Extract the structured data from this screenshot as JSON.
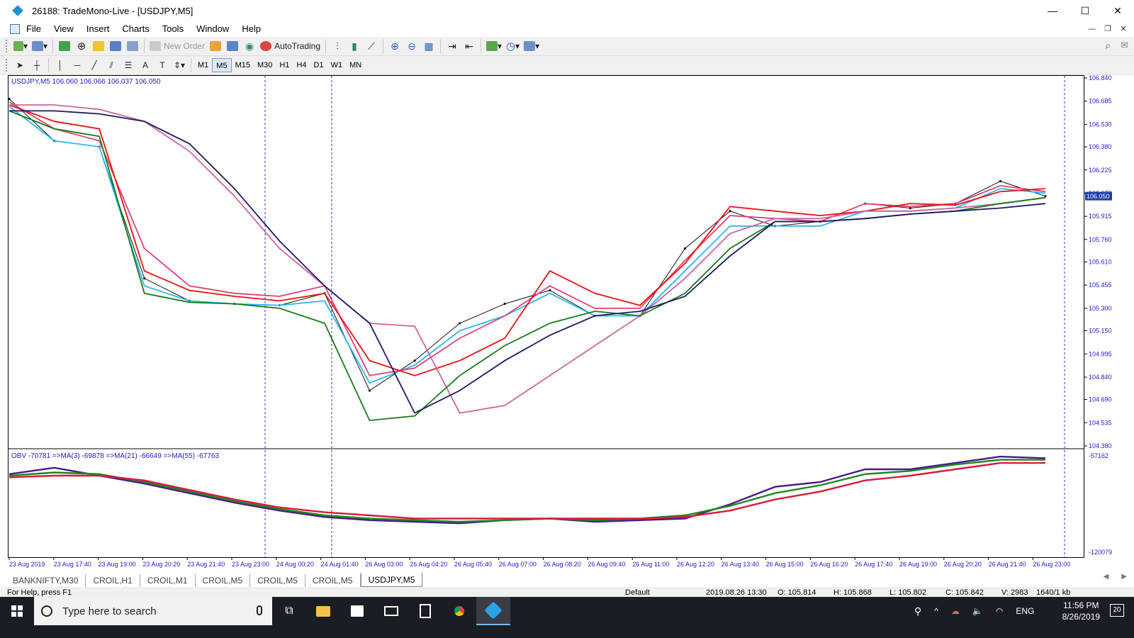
{
  "window": {
    "title": "26188: TradeMono-Live - [USDJPY,M5]",
    "minimize": "—",
    "maximize": "☐",
    "close": "✕"
  },
  "menu": [
    "File",
    "View",
    "Insert",
    "Charts",
    "Tools",
    "Window",
    "Help"
  ],
  "toolbar": {
    "new_order": "New Order",
    "autotrading": "AutoTrading"
  },
  "timeframes": [
    "M1",
    "M5",
    "M15",
    "M30",
    "H1",
    "H4",
    "D1",
    "W1",
    "MN"
  ],
  "active_timeframe": "M5",
  "chart": {
    "header": "USDJPY,M5  106.060 106.066 106.037 106.050",
    "current_price": "106.050",
    "price_ticks": [
      "106.840",
      "106.685",
      "106.530",
      "106.380",
      "106.225",
      "106.070",
      "105.915",
      "105.760",
      "105.610",
      "105.455",
      "105.300",
      "105.150",
      "104.995",
      "104.840",
      "104.690",
      "104.535",
      "104.380"
    ],
    "price_range": [
      104.38,
      106.84
    ],
    "time_labels": [
      "23 Aug 2019",
      "23 Aug 17:40",
      "23 Aug 19:00",
      "23 Aug 20:20",
      "23 Aug 21:40",
      "23 Aug 23:00",
      "24 Aug 00:20",
      "24 Aug 01:40",
      "26 Aug 03:00",
      "26 Aug 04:20",
      "26 Aug 05:40",
      "26 Aug 07:00",
      "26 Aug 08:20",
      "26 Aug 09:40",
      "26 Aug 11:00",
      "26 Aug 12:20",
      "26 Aug 13:40",
      "26 Aug 15:00",
      "26 Aug 16:20",
      "26 Aug 17:40",
      "26 Aug 19:00",
      "26 Aug 20:20",
      "26 Aug 21:40",
      "26 Aug 23:00"
    ],
    "indicator_header": "OBV -70781  =>MA(3) -69878  =>MA(21) -66649  =>MA(55) -67763",
    "indicator_ticks": [
      "-57162",
      "-120079"
    ]
  },
  "chart_data": {
    "type": "line",
    "title": "USDJPY,M5",
    "x": [
      "23 Aug 2019",
      "23 Aug 17:40",
      "23 Aug 19:00",
      "23 Aug 20:20",
      "23 Aug 21:40",
      "23 Aug 23:00",
      "24 Aug 00:20",
      "24 Aug 01:40",
      "26 Aug 03:00",
      "26 Aug 04:20",
      "26 Aug 05:40",
      "26 Aug 07:00",
      "26 Aug 08:20",
      "26 Aug 09:40",
      "26 Aug 11:00",
      "26 Aug 12:20",
      "26 Aug 13:40",
      "26 Aug 15:00",
      "26 Aug 16:20",
      "26 Aug 17:40",
      "26 Aug 19:00",
      "26 Aug 20:20",
      "26 Aug 21:40",
      "26 Aug 23:00"
    ],
    "series": [
      {
        "name": "USDJPY",
        "color": "#111111",
        "values": [
          106.7,
          106.42,
          106.38,
          105.5,
          105.35,
          105.33,
          105.32,
          105.4,
          104.75,
          104.95,
          105.2,
          105.33,
          105.42,
          105.25,
          105.25,
          105.7,
          105.95,
          105.85,
          105.88,
          106.0,
          105.97,
          106.0,
          106.15,
          106.05
        ]
      },
      {
        "color": "#29b6f6",
        "values": [
          106.65,
          106.42,
          106.38,
          105.45,
          105.35,
          105.33,
          105.32,
          105.35,
          104.8,
          104.92,
          105.15,
          105.25,
          105.4,
          105.25,
          105.25,
          105.55,
          105.85,
          105.85,
          105.85,
          105.95,
          105.95,
          105.97,
          106.1,
          106.07
        ]
      },
      {
        "color": "#e0407a",
        "values": [
          106.68,
          106.5,
          106.42,
          105.7,
          105.45,
          105.4,
          105.38,
          105.45,
          104.85,
          104.9,
          105.1,
          105.25,
          105.45,
          105.3,
          105.3,
          105.62,
          105.92,
          105.9,
          105.88,
          106.0,
          105.98,
          106.0,
          106.12,
          106.08
        ]
      },
      {
        "color": "#ee1111",
        "values": [
          106.66,
          106.55,
          106.5,
          105.55,
          105.42,
          105.38,
          105.35,
          105.4,
          104.95,
          104.85,
          104.95,
          105.1,
          105.55,
          105.4,
          105.32,
          105.6,
          105.98,
          105.95,
          105.92,
          105.95,
          106.0,
          105.99,
          106.08,
          106.1
        ]
      },
      {
        "color": "#cc6699",
        "values": [
          106.66,
          106.66,
          106.63,
          106.55,
          106.35,
          106.05,
          105.7,
          105.45,
          105.2,
          105.18,
          104.6,
          104.65,
          104.85,
          105.05,
          105.25,
          105.5,
          105.8,
          105.9,
          105.9,
          105.95,
          105.95,
          105.97,
          106.0,
          106.04
        ]
      },
      {
        "color": "#1a7a1a",
        "values": [
          106.62,
          106.5,
          106.45,
          105.4,
          105.34,
          105.33,
          105.3,
          105.2,
          104.55,
          104.58,
          104.85,
          105.05,
          105.2,
          105.28,
          105.25,
          105.4,
          105.7,
          105.88,
          105.88,
          105.9,
          105.93,
          105.95,
          106.0,
          106.04
        ]
      },
      {
        "color": "#1a1a66",
        "values": [
          106.62,
          106.62,
          106.6,
          106.55,
          106.4,
          106.1,
          105.75,
          105.45,
          105.2,
          104.6,
          104.75,
          104.95,
          105.12,
          105.25,
          105.28,
          105.38,
          105.65,
          105.88,
          105.88,
          105.9,
          105.93,
          105.95,
          105.97,
          106.0
        ]
      }
    ],
    "ylim": [
      104.38,
      106.84
    ],
    "grid": false,
    "indicator": {
      "name": "OBV",
      "ylim": [
        -120079,
        -57162
      ],
      "series": [
        {
          "name": "OBV",
          "color": "#4b1a8a",
          "values": [
            -70000,
            -66000,
            -71000,
            -76000,
            -82000,
            -88000,
            -93000,
            -97000,
            -99000,
            -100000,
            -101000,
            -99000,
            -98000,
            -100000,
            -99000,
            -98000,
            -89000,
            -78000,
            -75000,
            -67000,
            -67000,
            -63000,
            -59000,
            -60000
          ]
        },
        {
          "name": "MA(3)",
          "color": "#1a8a1a",
          "values": [
            -71000,
            -69000,
            -70000,
            -75000,
            -81000,
            -87000,
            -92000,
            -96000,
            -98000,
            -99000,
            -100000,
            -99000,
            -98000,
            -99000,
            -98000,
            -96000,
            -90000,
            -82000,
            -77000,
            -70000,
            -68000,
            -64000,
            -61000,
            -61000
          ]
        },
        {
          "name": "MA(21)",
          "color": "#d81b3c",
          "values": [
            -72000,
            -71000,
            -71000,
            -74000,
            -80000,
            -86000,
            -91000,
            -94000,
            -96000,
            -98000,
            -98000,
            -98000,
            -98000,
            -98000,
            -98000,
            -97000,
            -93000,
            -86000,
            -81000,
            -74000,
            -71000,
            -67000,
            -63000,
            -63000
          ]
        }
      ]
    }
  },
  "tabs": [
    "BANKNIFTY,M30",
    "CROIL,H1",
    "CROIL,M1",
    "CROIL,M5",
    "CROIL,M5",
    "CROIL,M5",
    "USDJPY,M5"
  ],
  "active_tab": "USDJPY,M5",
  "status": {
    "help": "For Help, press F1",
    "profile": "Default",
    "datetime": "2019.08.26 13:30",
    "open": "O: 105.814",
    "high": "H: 105.868",
    "low": "L: 105.802",
    "close": "C: 105.842",
    "volume": "V: 2983",
    "traffic": "1640/1 kb"
  },
  "taskbar": {
    "search_placeholder": "Type here to search",
    "time": "11:56 PM",
    "date": "8/26/2019",
    "lang": "ENG",
    "notifications": "20"
  }
}
